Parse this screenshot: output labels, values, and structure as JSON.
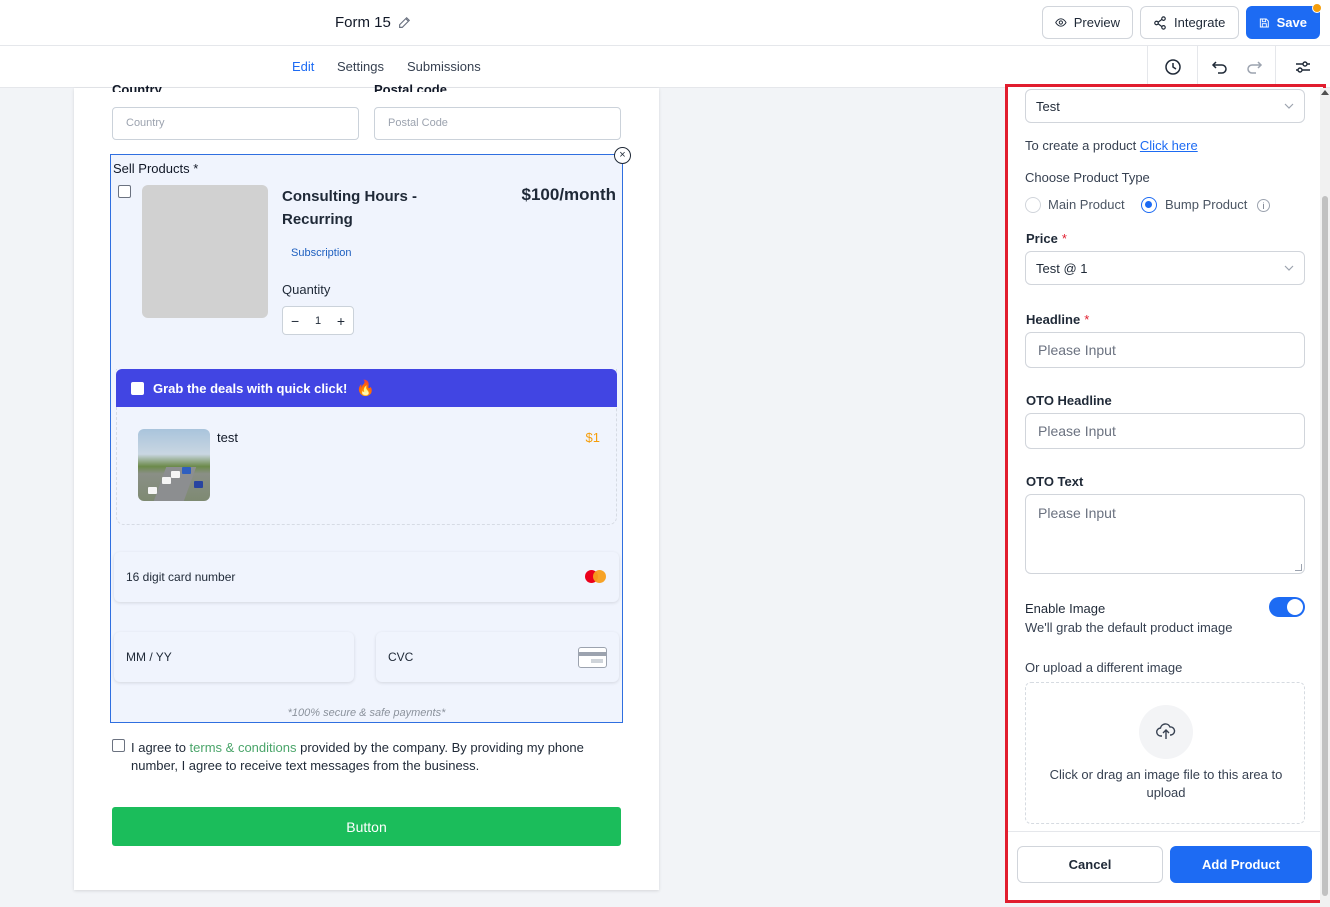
{
  "header": {
    "form_title": "Form 15",
    "preview_label": "Preview",
    "integrate_label": "Integrate",
    "save_label": "Save",
    "accent": "#1d6bf3"
  },
  "tabs": [
    {
      "label": "Edit",
      "active": true
    },
    {
      "label": "Settings",
      "active": false
    },
    {
      "label": "Submissions",
      "active": false
    }
  ],
  "form": {
    "country_label": "Country",
    "postal_label": "Postal code",
    "country_placeholder": "Country",
    "postal_placeholder": "Postal Code",
    "sell_products_title": "Sell Products *",
    "product": {
      "name": "Consulting Hours - Recurring",
      "price": "$100/month",
      "type_tag": "Subscription",
      "quantity_label": "Quantity",
      "quantity_value": "1"
    },
    "bump": {
      "headline": "Grab the deals with quick click!",
      "name": "test",
      "price": "$1"
    },
    "card_number_placeholder": "16 digit card number",
    "expiry_placeholder": "MM / YY",
    "cvc_placeholder": "CVC",
    "secure_note": "*100% secure & safe payments*",
    "agree_prefix": "I agree to ",
    "agree_link": "terms & conditions",
    "agree_suffix": " provided by the company. By providing my phone number, I agree to receive text messages from the business.",
    "submit_label": "Button",
    "submit_color": "#1bbd5b"
  },
  "panel": {
    "product_select_value": "Test",
    "create_prefix": "To create a product ",
    "create_link": "Click here",
    "product_type_label": "Choose Product Type",
    "product_types": [
      {
        "label": "Main Product",
        "selected": false
      },
      {
        "label": "Bump Product",
        "selected": true
      }
    ],
    "price_label": "Price",
    "price_value": "Test @ 1",
    "headline_label": "Headline",
    "headline_placeholder": "Please Input",
    "oto_headline_label": "OTO Headline",
    "oto_headline_placeholder": "Please Input",
    "oto_text_label": "OTO Text",
    "oto_text_placeholder": "Please Input",
    "enable_image_label": "Enable Image",
    "enable_image_on": true,
    "enable_image_hint": "We'll grab the default product image",
    "upload_label": "Or upload a different image",
    "upload_text": "Click or drag an image file to this area to upload",
    "cancel_label": "Cancel",
    "add_label": "Add Product",
    "highlight_color": "#e11d2e"
  }
}
